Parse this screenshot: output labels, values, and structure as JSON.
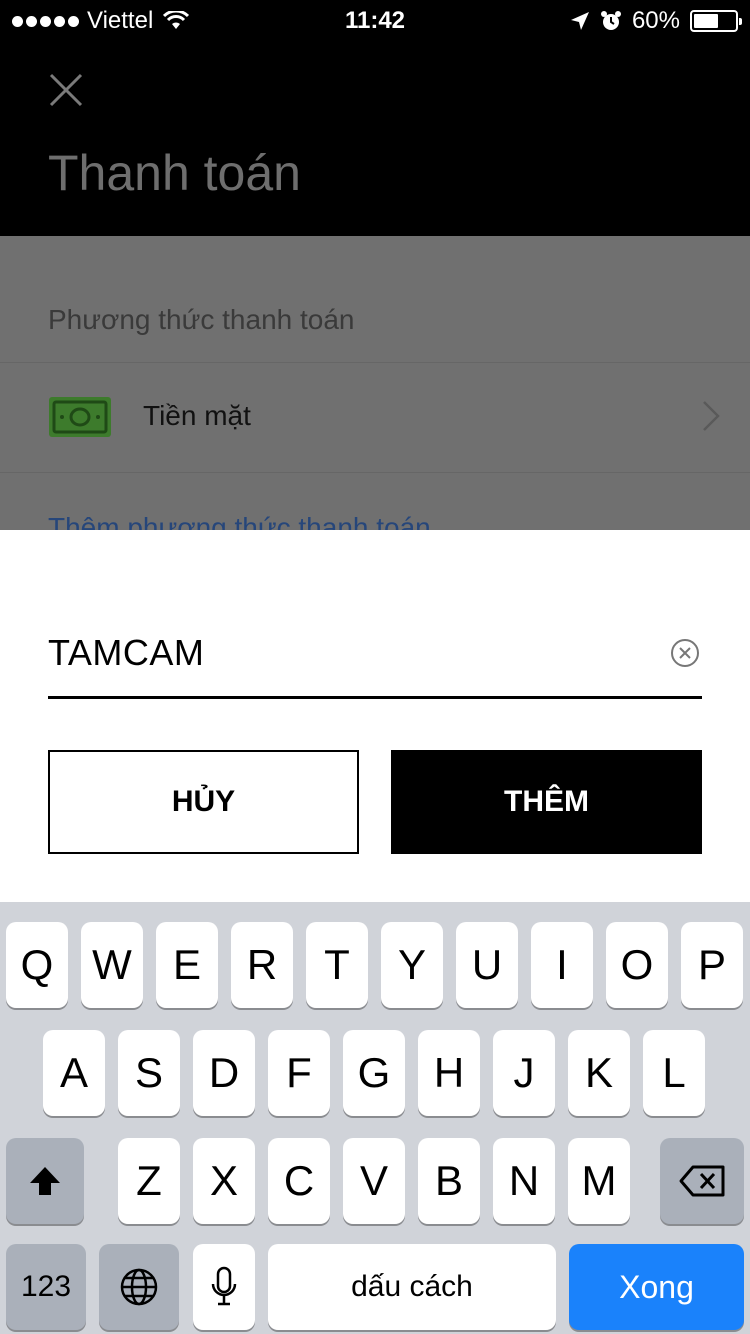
{
  "status_bar": {
    "carrier": "Viettel",
    "time": "11:42",
    "battery_percent": "60%",
    "battery_level": 0.6
  },
  "header": {
    "title": "Thanh toán"
  },
  "payment": {
    "section_label": "Phương thức thanh toán",
    "cash_label": "Tiền mặt",
    "add_method_label": "Thêm phương thức thanh toán"
  },
  "promo": {
    "value": "TAMCAM",
    "cancel_label": "HỦY",
    "add_label": "THÊM"
  },
  "keyboard": {
    "row1": [
      "Q",
      "W",
      "E",
      "R",
      "T",
      "Y",
      "U",
      "I",
      "O",
      "P"
    ],
    "row2": [
      "A",
      "S",
      "D",
      "F",
      "G",
      "H",
      "J",
      "K",
      "L"
    ],
    "row3": [
      "Z",
      "X",
      "C",
      "V",
      "B",
      "N",
      "M"
    ],
    "numbers_label": "123",
    "space_label": "dấu cách",
    "done_label": "Xong"
  },
  "colors": {
    "done_key": "#1a82fb",
    "cash_icon": "#3d7b2c"
  }
}
